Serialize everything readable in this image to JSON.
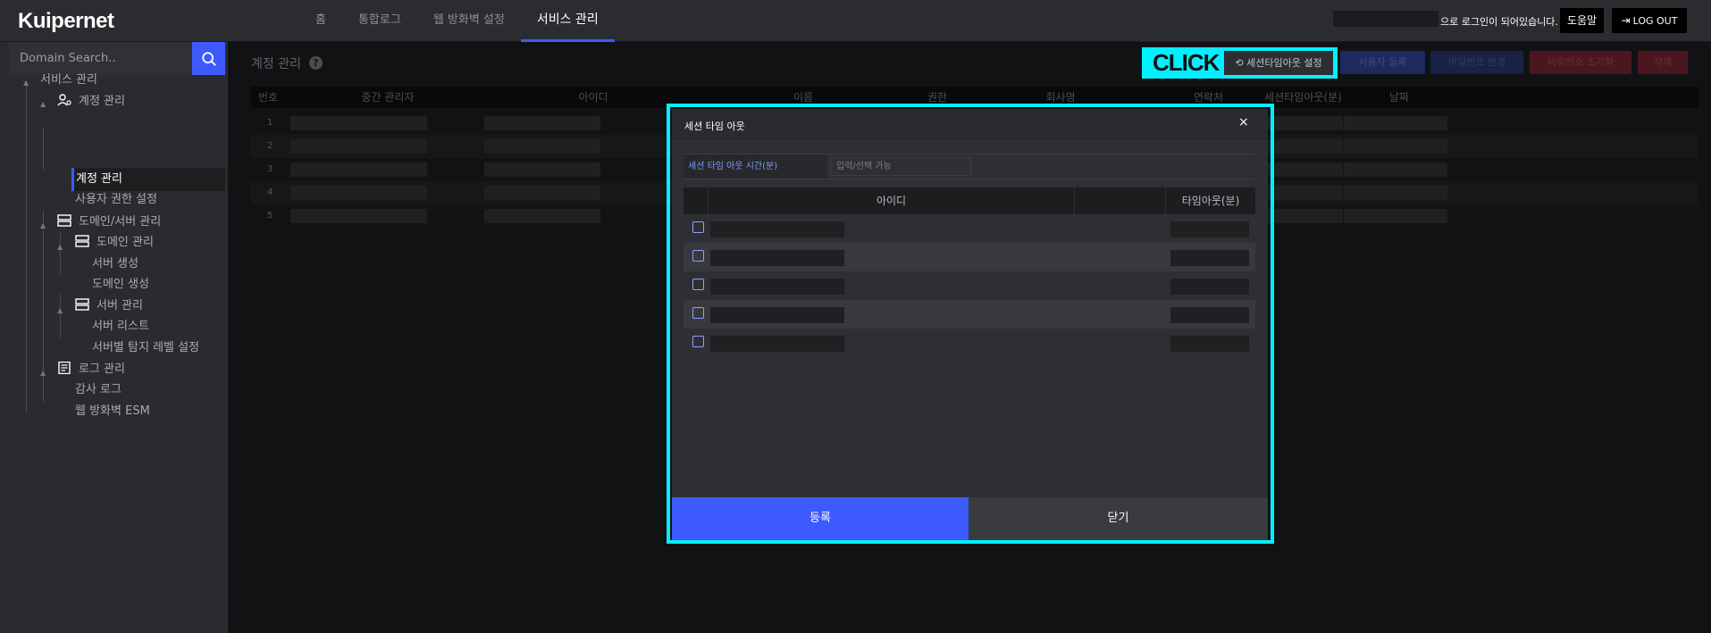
{
  "app": {
    "logo": "Kuipernet"
  },
  "nav": {
    "items": [
      {
        "label": "홈"
      },
      {
        "label": "통합로그"
      },
      {
        "label": "웹 방화벽 설정"
      },
      {
        "label": "서비스 관리",
        "active": true
      }
    ]
  },
  "header": {
    "login_suffix": "으로 로그인이 되어있습니다.",
    "help_label": "도움말",
    "logout_label": "LOG OUT"
  },
  "sidebar": {
    "search_placeholder": "Domain Search..",
    "tree": [
      {
        "label": "서비스 관리",
        "icon": "none"
      },
      {
        "label": "계정 관리",
        "icon": "user-gear-icon"
      },
      {
        "label": "계정 관리",
        "active": true
      },
      {
        "label": "사용자 권한 설정"
      },
      {
        "label": "도메인/서버 관리",
        "icon": "server-icon"
      },
      {
        "label": "도메인 관리",
        "icon": "server-icon"
      },
      {
        "label": "서버 생성"
      },
      {
        "label": "도메인 생성"
      },
      {
        "label": "서버 관리",
        "icon": "server-icon"
      },
      {
        "label": "서버 리스트"
      },
      {
        "label": "서버별 탐지 레벨 설정"
      },
      {
        "label": "로그 관리",
        "icon": "document-icon"
      },
      {
        "label": "감사 로그"
      },
      {
        "label": "웹 방화벽 ESM"
      }
    ]
  },
  "main": {
    "title": "계정 관리",
    "toolbar": {
      "click_label": "CLICK",
      "session_timeout": "세션타임아웃 설정",
      "add_user": "사용자 등록",
      "change_password": "비밀번호 변경",
      "reset_password": "비밀번호 초기화",
      "delete": "삭제"
    },
    "table": {
      "headers": [
        "번호",
        "중간 관리자",
        "아이디",
        "이름",
        "권한",
        "회사명",
        "연락처",
        "세션타임아웃(분)",
        "날짜"
      ],
      "rows": [
        "1",
        "2",
        "3",
        "4",
        "5"
      ]
    }
  },
  "modal": {
    "title": "세션 타임 아웃",
    "close_symbol": "×",
    "field_label": "세션 타임 아웃 시간(분)",
    "field_placeholder": "입력/선택 가능",
    "headers": {
      "id": "아이디",
      "timeout": "타임아웃(분)"
    },
    "row_count": 5,
    "register_label": "등록",
    "close_label": "닫기"
  },
  "colors": {
    "accent": "#3d5afe",
    "highlight": "#00f0ff",
    "topbar": "#2b2c30",
    "sidebar": "#2a2b2e"
  }
}
